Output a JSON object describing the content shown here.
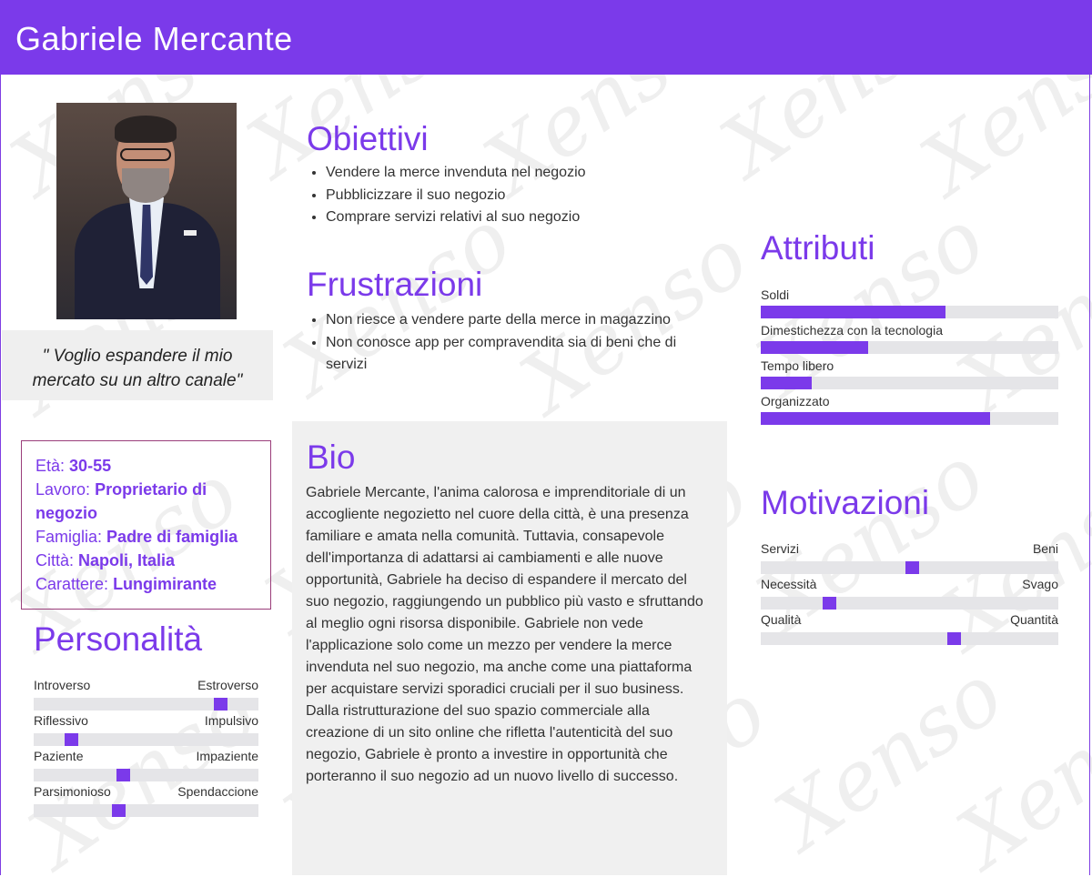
{
  "header": {
    "name": "Gabriele Mercante"
  },
  "quote": "\" Voglio espandere il mio mercato su un altro canale\"",
  "info": {
    "age_label": "Età:",
    "age_value": "30-55",
    "job_label": "Lavoro:",
    "job_value": "Proprietario di negozio",
    "family_label": "Famiglia:",
    "family_value": "Padre di famiglia",
    "city_label": "Città:",
    "city_value": "Napoli, Italia",
    "character_label": "Carattere:",
    "character_value": "Lungimirante"
  },
  "goals": {
    "title": "Obiettivi",
    "items": [
      "Vendere la merce invenduta nel negozio",
      "Pubblicizzare il suo negozio",
      "Comprare servizi relativi al suo negozio"
    ]
  },
  "frustrations": {
    "title": "Frustrazioni",
    "items": [
      "Non riesce a vendere parte della merce in magazzino",
      "Non conosce app per compravendita sia di beni che di servizi"
    ]
  },
  "bio": {
    "title": "Bio",
    "text": "Gabriele Mercante, l'anima calorosa e imprenditoriale di un accogliente negozietto nel cuore della città, è una presenza familiare e amata nella comunità. Tuttavia, consapevole dell'importanza di adattarsi ai cambiamenti e alle nuove opportunità, Gabriele ha deciso di espandere il mercato del suo negozio, raggiungendo un pubblico più vasto e sfruttando al meglio ogni risorsa disponibile. Gabriele non vede l'applicazione solo come un mezzo per vendere la merce invenduta nel suo negozio, ma anche come una piattaforma per acquistare servizi sporadici cruciali per il suo business. Dalla ristrutturazione del suo spazio commerciale alla creazione di un sito online che rifletta l'autenticità del suo negozio, Gabriele è pronto a investire in opportunità che porteranno il suo negozio ad un nuovo livello di successo."
  },
  "personality": {
    "title": "Personalità",
    "sliders": [
      {
        "left": "Introverso",
        "right": "Estroverso",
        "value": 0.83
      },
      {
        "left": "Riflessivo",
        "right": "Impulsivo",
        "value": 0.17
      },
      {
        "left": "Paziente",
        "right": "Impaziente",
        "value": 0.4
      },
      {
        "left": "Parsimonioso",
        "right": "Spendaccione",
        "value": 0.38
      }
    ]
  },
  "attributes": {
    "title": "Attributi",
    "bars": [
      {
        "label": "Soldi",
        "value": 0.62
      },
      {
        "label": "Dimestichezza con la tecnologia",
        "value": 0.36
      },
      {
        "label": "Tempo libero",
        "value": 0.17
      },
      {
        "label": "Organizzato",
        "value": 0.77
      }
    ]
  },
  "motivations": {
    "title": "Motivazioni",
    "sliders": [
      {
        "left": "Servizi",
        "right": "Beni",
        "value": 0.51
      },
      {
        "left": "Necessità",
        "right": "Svago",
        "value": 0.23
      },
      {
        "left": "Qualità",
        "right": "Quantità",
        "value": 0.65
      }
    ]
  },
  "colors": {
    "accent": "#7b3aea",
    "panel": "#f0f0f0",
    "track": "#e5e5e8"
  }
}
